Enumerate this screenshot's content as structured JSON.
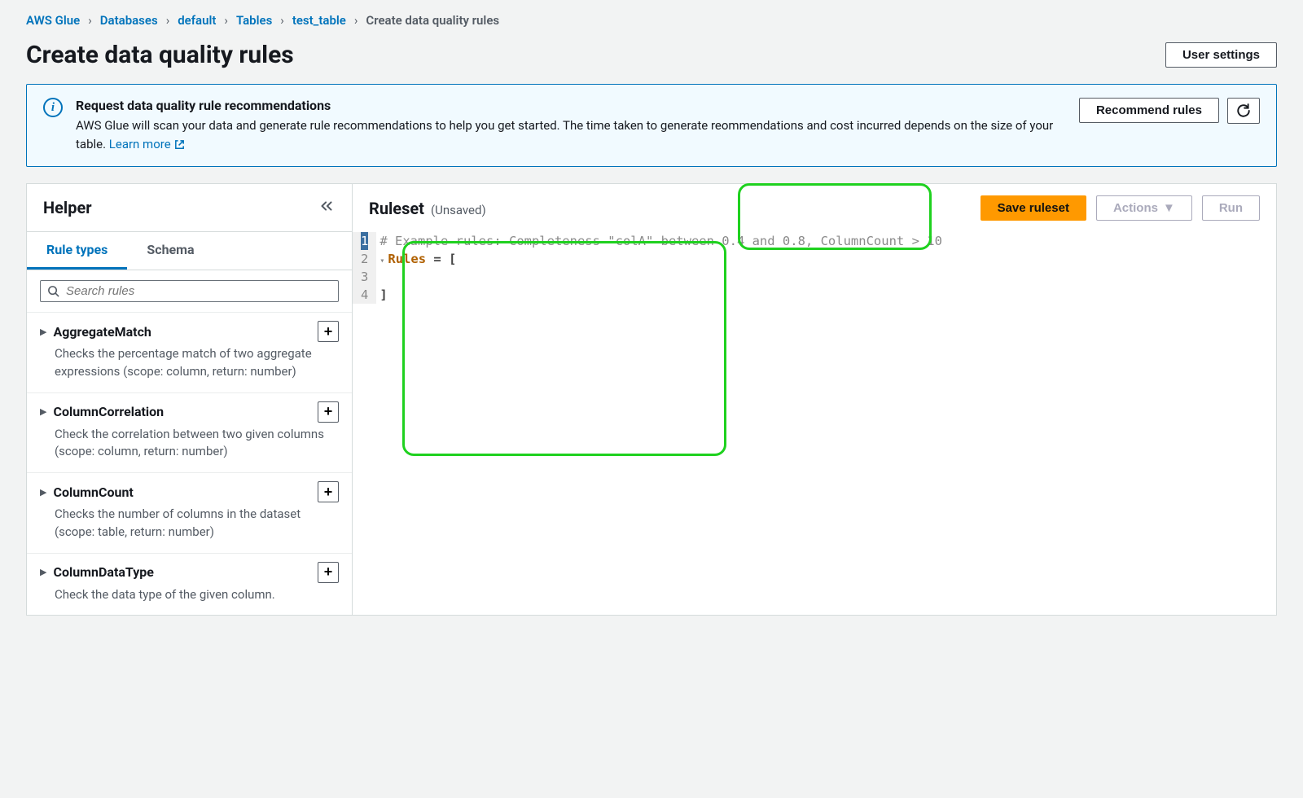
{
  "breadcrumb": [
    {
      "label": "AWS Glue",
      "link": true
    },
    {
      "label": "Databases",
      "link": true
    },
    {
      "label": "default",
      "link": true
    },
    {
      "label": "Tables",
      "link": true
    },
    {
      "label": "test_table",
      "link": true
    },
    {
      "label": "Create data quality rules",
      "link": false
    }
  ],
  "page_title": "Create data quality rules",
  "user_settings_btn": "User settings",
  "info_banner": {
    "title": "Request data quality rule recommendations",
    "desc": "AWS Glue will scan your data and generate rule recommendations to help you get started. The time taken to generate reommendations and cost incurred depends on the size of your table. ",
    "learn_more": "Learn more ",
    "recommend_btn": "Recommend rules"
  },
  "helper": {
    "title": "Helper",
    "tabs": {
      "rule_types": "Rule types",
      "schema": "Schema"
    },
    "search_placeholder": "Search rules",
    "rules": [
      {
        "name": "AggregateMatch",
        "desc": "Checks the percentage match of two aggregate expressions (scope: column, return: number)"
      },
      {
        "name": "ColumnCorrelation",
        "desc": "Check the correlation between two given columns (scope: column, return: number)"
      },
      {
        "name": "ColumnCount",
        "desc": "Checks the number of columns in the dataset (scope: table, return: number)"
      },
      {
        "name": "ColumnDataType",
        "desc": "Check the data type of the given column."
      }
    ]
  },
  "ruleset": {
    "title": "Ruleset",
    "status": "(Unsaved)",
    "save_btn": "Save ruleset",
    "actions_btn": "Actions",
    "run_btn": "Run",
    "code_lines": {
      "l1_comment": "# Example rules: Completeness \"colA\" between 0.4 and 0.8, ColumnCount > 10",
      "l2_keyword": "Rules",
      "l2_rest": " = [",
      "l3": "",
      "l4": "]"
    }
  }
}
